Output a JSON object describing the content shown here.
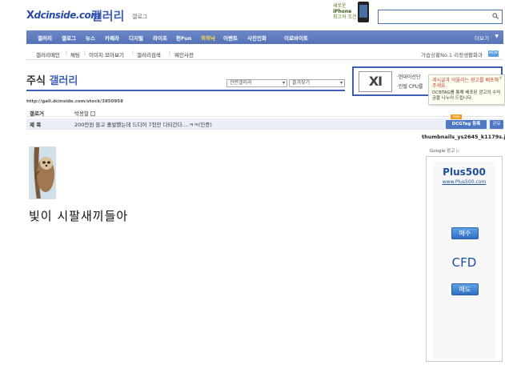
{
  "header": {
    "logo_x": "X",
    "logo_text": "dcinside.com",
    "site_title": "갤러리",
    "site_sub": "갤로그",
    "ad_text_line1": "새로운",
    "ad_text_line2": "iPhone",
    "ad_text_line3": "최고의 조건"
  },
  "nav": {
    "items": [
      "갤러리",
      "갤로그",
      "뉴스",
      "카페라",
      "디지털",
      "라이프",
      "펀Fun",
      "히히낙",
      "이벤트",
      "사진인화",
      "이로바이트"
    ],
    "more": "더보기"
  },
  "subnav": {
    "items": [
      "갤러리메인",
      "채팅",
      "이미지 모아보기",
      "갤러리검색",
      "웨인사전"
    ],
    "right": "가습상황No.1 리정생활화과",
    "badge": "NEW"
  },
  "gallery": {
    "title_prefix": "주식",
    "title": "갤러리",
    "select1": "관련갤러리",
    "select2": "즐겨찾기"
  },
  "dc_ad": {
    "logo": "XI",
    "line1": "·현대아산단",
    "line2": "·인텔 CPU를"
  },
  "tooltip": {
    "line1": "게시글과 어울리는 광고를 배포해주세요.",
    "line2": "DCBTAG를 통해 배포된 광고의 수익금을 나누어 드립니다.",
    "close": "×"
  },
  "post": {
    "url": "http://gall.dcinside.com/stock/3850958",
    "writer_label": "갤로거",
    "writer": "박용말",
    "title_label": "제 목",
    "title": "200만원 들고 졸발했는데 드디어 7천만 다되간다....ㅋㅋ(인증)",
    "dctag": "DCGTag 등록",
    "dctag_new": "new",
    "share": "공유",
    "filename": "thumbnails_ys2645_k1179s.jpg",
    "body_text": "빛이 시팔새끼들아"
  },
  "google_ad": {
    "label": "Google 광고 ▷",
    "brand": "Plus500",
    "url": "www.Plus500.com",
    "buy": "매수",
    "cfd": "CFD",
    "sell": "매도"
  }
}
